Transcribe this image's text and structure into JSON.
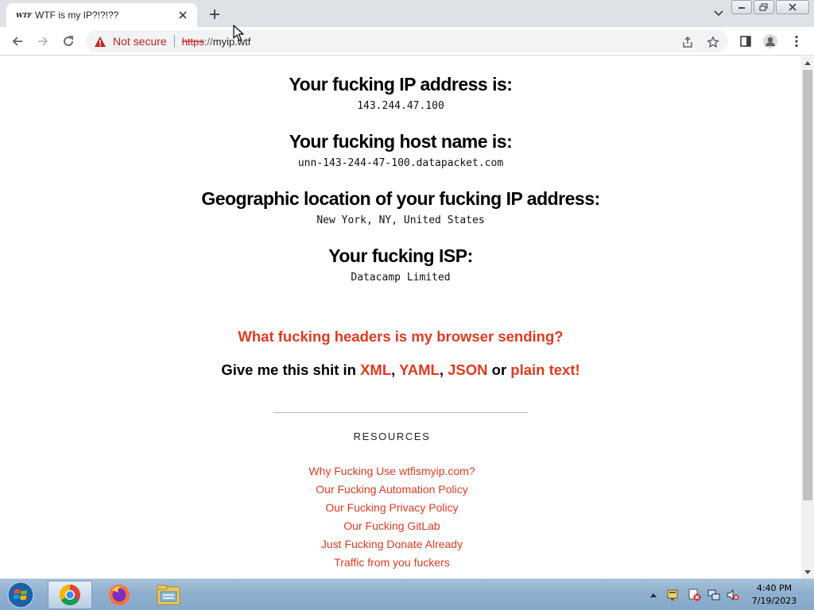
{
  "browser": {
    "tab": {
      "favicon_text": "WTF",
      "title": "WTF is my IP?!?!??",
      "close_icon": "close-icon"
    },
    "new_tab_icon": "plus-icon",
    "toolbar": {
      "back_icon": "arrow-left-icon",
      "forward_icon": "arrow-right-icon",
      "reload_icon": "reload-icon"
    },
    "omnibox": {
      "security_label": "Not secure",
      "url_scheme": "https",
      "url_separator": "://",
      "url_host": "myip.wtf"
    }
  },
  "page": {
    "ip": {
      "heading": "Your fucking IP address is:",
      "value": "143.244.47.100"
    },
    "host": {
      "heading": "Your fucking host name is:",
      "value": "unn-143-244-47-100.datapacket.com"
    },
    "geo": {
      "heading": "Geographic location of your fucking IP address:",
      "value": "New York, NY, United States"
    },
    "isp": {
      "heading": "Your fucking ISP:",
      "value": "Datacamp Limited"
    },
    "headers_link": "What fucking headers is my browser sending?",
    "formats": {
      "prefix": "Give me this shit in ",
      "xml": "XML",
      "comma1": ", ",
      "yaml": "YAML",
      "comma2": ", ",
      "json": "JSON",
      "or": " or ",
      "plain": "plain text!"
    },
    "resources": {
      "title": "RESOURCES",
      "items": [
        "Why Fucking Use wtfismyip.com?",
        "Our Fucking Automation Policy",
        "Our Fucking Privacy Policy",
        "Our Fucking GitLab",
        "Just Fucking Donate Already",
        "Traffic from you fuckers"
      ]
    }
  },
  "colors": {
    "accent": "#e03a1e",
    "insecure": "#c5221f",
    "taskbar": "#8fb0cf"
  },
  "taskbar": {
    "time": "4:40 PM",
    "date": "7/19/2023"
  }
}
